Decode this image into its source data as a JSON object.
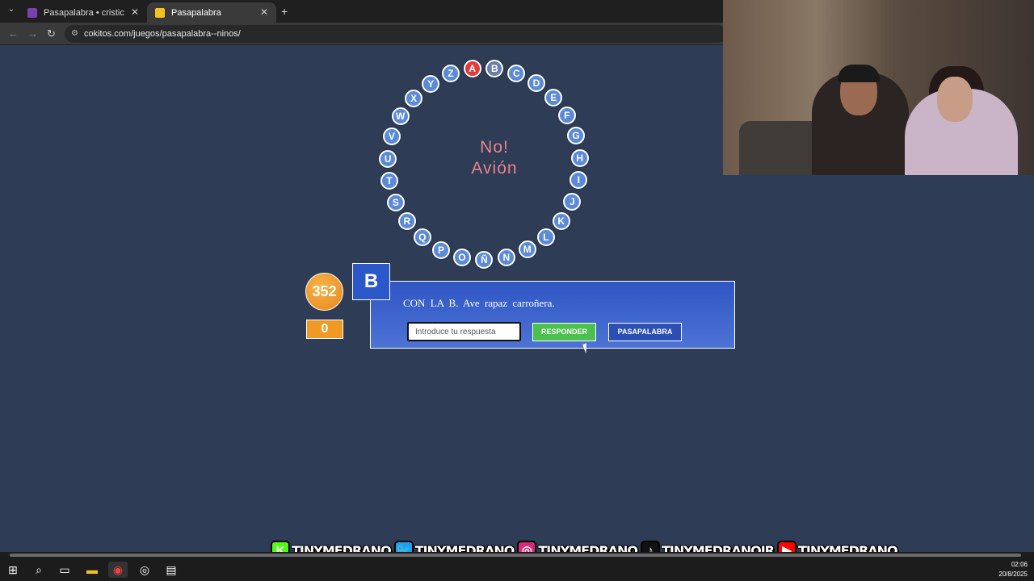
{
  "browser": {
    "tabs": [
      {
        "title": "Pasapalabra • cristic",
        "active": false
      },
      {
        "title": "Pasapalabra",
        "active": true
      }
    ],
    "new_tab": "+",
    "url": "cokitos.com/juegos/pasapalabra--ninos/"
  },
  "rosco": {
    "letters": [
      "A",
      "B",
      "C",
      "D",
      "E",
      "F",
      "G",
      "H",
      "I",
      "J",
      "K",
      "L",
      "M",
      "N",
      "Ñ",
      "O",
      "P",
      "Q",
      "R",
      "S",
      "T",
      "U",
      "V",
      "W",
      "X",
      "Y",
      "Z"
    ],
    "current": "A",
    "passed": [
      "B"
    ],
    "feedback_line1": "No!",
    "feedback_line2": "Avión"
  },
  "game": {
    "timer": "352",
    "score": "0",
    "current_letter": "B",
    "question": "CON LA B. Ave rapaz carroñera.",
    "answer_placeholder": "Introduce tu respuesta",
    "responder_label": "RESPONDER",
    "pasapalabra_label": "PASAPALABRA"
  },
  "socials": [
    {
      "icon": "kick-icon",
      "glyph": "K",
      "color": "#53fc18",
      "handle": "TINYMEDRANO"
    },
    {
      "icon": "twitter-icon",
      "glyph": "🐦",
      "color": "#1da1f2",
      "handle": "TINYMEDRANO"
    },
    {
      "icon": "instagram-icon",
      "glyph": "◎",
      "color": "#d62976",
      "handle": "TINYMEDRANO"
    },
    {
      "icon": "tiktok-icon",
      "glyph": "♪",
      "color": "#111111",
      "handle": "TINYMEDRANOJR"
    },
    {
      "icon": "youtube-icon",
      "glyph": "▶",
      "color": "#ff0000",
      "handle": "TINYMEDRANO"
    }
  ],
  "taskbar": {
    "time": "02:06",
    "date": "20/8/2025"
  }
}
